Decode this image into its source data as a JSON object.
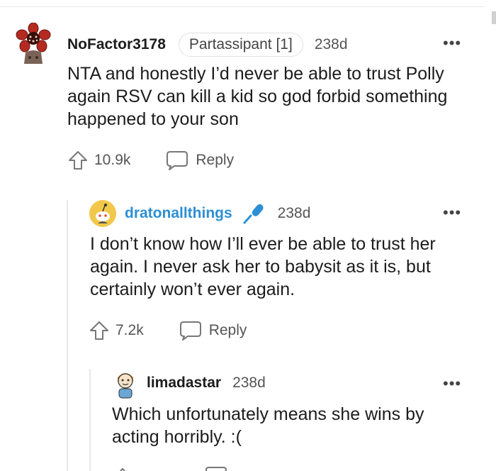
{
  "comments": [
    {
      "username": "NoFactor3178",
      "flair": "Partassipant [1]",
      "age": "238d",
      "more": "•••",
      "body": "NTA and honestly I’d never be able to trust Polly again RSV can kill a kid so god forbid something happened to your son",
      "votes": "10.9k",
      "reply_label": "Reply",
      "avatar_icon": "flower-monster-avatar"
    },
    {
      "username": "dratonallthings",
      "age": "238d",
      "more": "•••",
      "body": "I don’t know how I’ll ever be able to trust her again. I never ask her to babysit as it is, but certainly won’t ever again.",
      "votes": "7.2k",
      "reply_label": "Reply",
      "avatar_icon": "snoo-avatar",
      "badge_icon": "microphone-icon",
      "accent_color": "#2d8fd5"
    },
    {
      "username": "limadastar",
      "age": "238d",
      "more": "•••",
      "body": "Which unfortunately means she wins by acting horribly. :(",
      "avatar_icon": "cartoon-person-avatar"
    }
  ]
}
